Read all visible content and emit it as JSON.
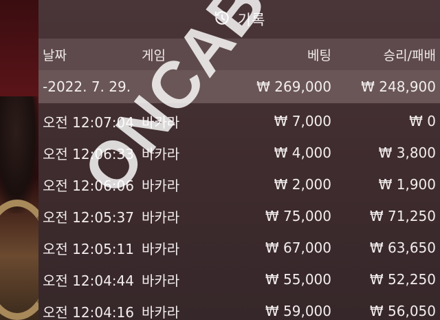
{
  "title": "기록",
  "icon": "history-icon",
  "headers": {
    "date": "날짜",
    "game": "게임",
    "bet": "베팅",
    "win": "승리/패배"
  },
  "summary": {
    "date": "-2022. 7. 29.",
    "bet": "₩ 269,000",
    "win": "₩ 248,900"
  },
  "rows": [
    {
      "time": "오전 12:07:04",
      "game": "바카라",
      "bet": "₩ 7,000",
      "win": "₩ 0"
    },
    {
      "time": "오전 12:06:33",
      "game": "바카라",
      "bet": "₩ 4,000",
      "win": "₩ 3,800"
    },
    {
      "time": "오전 12:06:06",
      "game": "바카라",
      "bet": "₩ 2,000",
      "win": "₩ 1,900"
    },
    {
      "time": "오전 12:05:37",
      "game": "바카라",
      "bet": "₩ 75,000",
      "win": "₩ 71,250"
    },
    {
      "time": "오전 12:05:11",
      "game": "바카라",
      "bet": "₩ 67,000",
      "win": "₩ 63,650"
    },
    {
      "time": "오전 12:04:44",
      "game": "바카라",
      "bet": "₩ 55,000",
      "win": "₩ 52,250"
    },
    {
      "time": "오전 12:04:16",
      "game": "바카라",
      "bet": "₩ 59,000",
      "win": "₩ 56,050"
    }
  ],
  "watermark": "ONCABEST"
}
